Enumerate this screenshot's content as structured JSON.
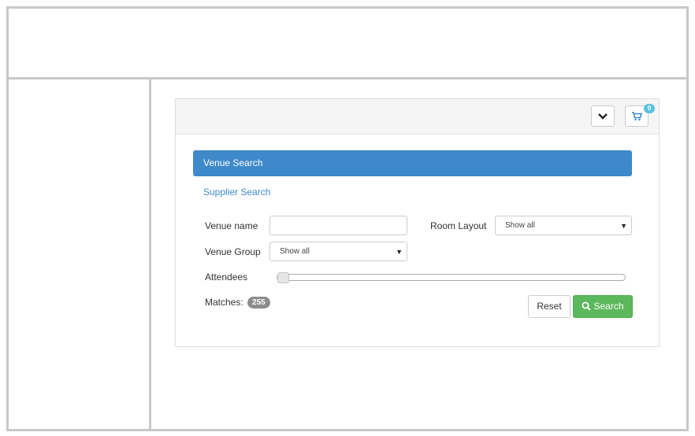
{
  "header": {
    "collapse_icon": "chevron-down-icon",
    "cart_icon": "cart-icon",
    "cart_count": "0"
  },
  "tabs": [
    {
      "label": "Venue Search",
      "active": true
    },
    {
      "label": "Supplier Search",
      "active": false
    }
  ],
  "form": {
    "venue_name": {
      "label": "Venue name",
      "value": ""
    },
    "room_layout": {
      "label": "Room Layout",
      "selected": "Show all"
    },
    "venue_group": {
      "label": "Venue Group",
      "selected": "Show all"
    },
    "attendees": {
      "label": "Attendees",
      "min_selected": 0
    },
    "matches": {
      "label": "Matches:",
      "count": "255"
    }
  },
  "buttons": {
    "reset": "Reset",
    "search": "Search",
    "search_icon": "search-icon"
  },
  "colors": {
    "primary": "#3e89ca",
    "success": "#5cb85c",
    "info_badge": "#5bc0de",
    "neutral_badge": "#8c8c8c"
  }
}
